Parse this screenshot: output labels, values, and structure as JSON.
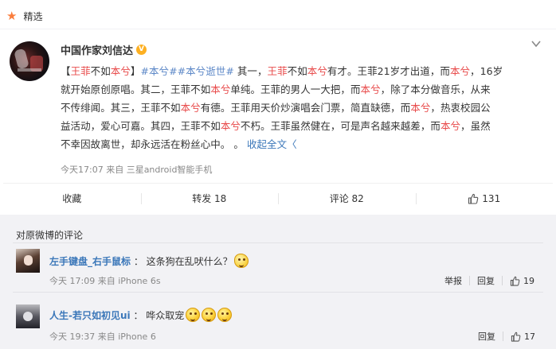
{
  "header": {
    "label": "精选"
  },
  "post": {
    "author": "中国作家刘信达",
    "verified_badge": "V",
    "lines": [
      [
        {
          "t": "【",
          "c": "t1"
        },
        {
          "t": "王菲",
          "c": "red"
        },
        {
          "t": "不如",
          "c": "t1"
        },
        {
          "t": "本兮",
          "c": "red"
        },
        {
          "t": "】",
          "c": "t1"
        },
        {
          "t": "#本兮##本兮逝世#",
          "c": "blue"
        },
        {
          "t": " 其一，",
          "c": "t1"
        },
        {
          "t": "王菲",
          "c": "red"
        },
        {
          "t": "不如",
          "c": "t1"
        },
        {
          "t": "本兮",
          "c": "red"
        },
        {
          "t": "有才。王菲21岁才出道，而",
          "c": "t1"
        },
        {
          "t": "本兮",
          "c": "red"
        },
        {
          "t": "，16岁",
          "c": "t1"
        }
      ],
      [
        {
          "t": "就开始原创原唱。其二，王菲不如",
          "c": "t1"
        },
        {
          "t": "本兮",
          "c": "red"
        },
        {
          "t": "单纯。王菲的男人一大把，而",
          "c": "t1"
        },
        {
          "t": "本兮",
          "c": "red"
        },
        {
          "t": "，除了本分做音乐，从来",
          "c": "t1"
        }
      ],
      [
        {
          "t": "不传绯闻。其三，王菲不如",
          "c": "t1"
        },
        {
          "t": "本兮",
          "c": "red"
        },
        {
          "t": "有德。王菲用天价炒演唱会门票，简直缺德，而",
          "c": "t1"
        },
        {
          "t": "本兮",
          "c": "red"
        },
        {
          "t": "，热衷校园公",
          "c": "t1"
        }
      ],
      [
        {
          "t": "益活动，爱心可嘉。其四，王菲不如",
          "c": "t1"
        },
        {
          "t": "本兮",
          "c": "red"
        },
        {
          "t": "不朽。王菲虽然健在，可是声名越来越差，而",
          "c": "t1"
        },
        {
          "t": "本兮",
          "c": "red"
        },
        {
          "t": "，虽然",
          "c": "t1"
        }
      ],
      [
        {
          "t": "不幸因故离世，却永远活在粉丝心中。 。 ",
          "c": "t1"
        },
        {
          "t": "收起全文",
          "c": "link"
        },
        {
          "t": "〈",
          "c": "link"
        }
      ]
    ],
    "meta": "今天17:07 来自 三星android智能手机",
    "actions": {
      "favorite": "收藏",
      "repost": "转发 18",
      "comment": "评论 82",
      "like_count": "131"
    }
  },
  "comments_section": {
    "title": "对原微博的评论",
    "comments": [
      {
        "user": "左手键盘_右手鼠标",
        "text": "这条狗在乱吠什么？",
        "emojis": 1,
        "time": "今天 17:09 来自 iPhone 6s",
        "report": "举报",
        "reply": "回复",
        "likes": "19"
      },
      {
        "user": "人生-若只如初见ui",
        "text": "哗众取宠",
        "emojis": 3,
        "time": "今天 19:37 来自 iPhone 6",
        "report": "",
        "reply": "回复",
        "likes": "17"
      }
    ]
  },
  "colors": {
    "accent_red": "#e84b4b",
    "topic_blue": "#5b87c7",
    "link_blue": "#3b77b9",
    "star_orange": "#fa7d3c",
    "badge_gold": "#fdb022"
  },
  "icons": [
    "star-icon",
    "chevron-down-icon",
    "verified-badge-icon",
    "thumb-up-icon",
    "emoji-icon"
  ]
}
